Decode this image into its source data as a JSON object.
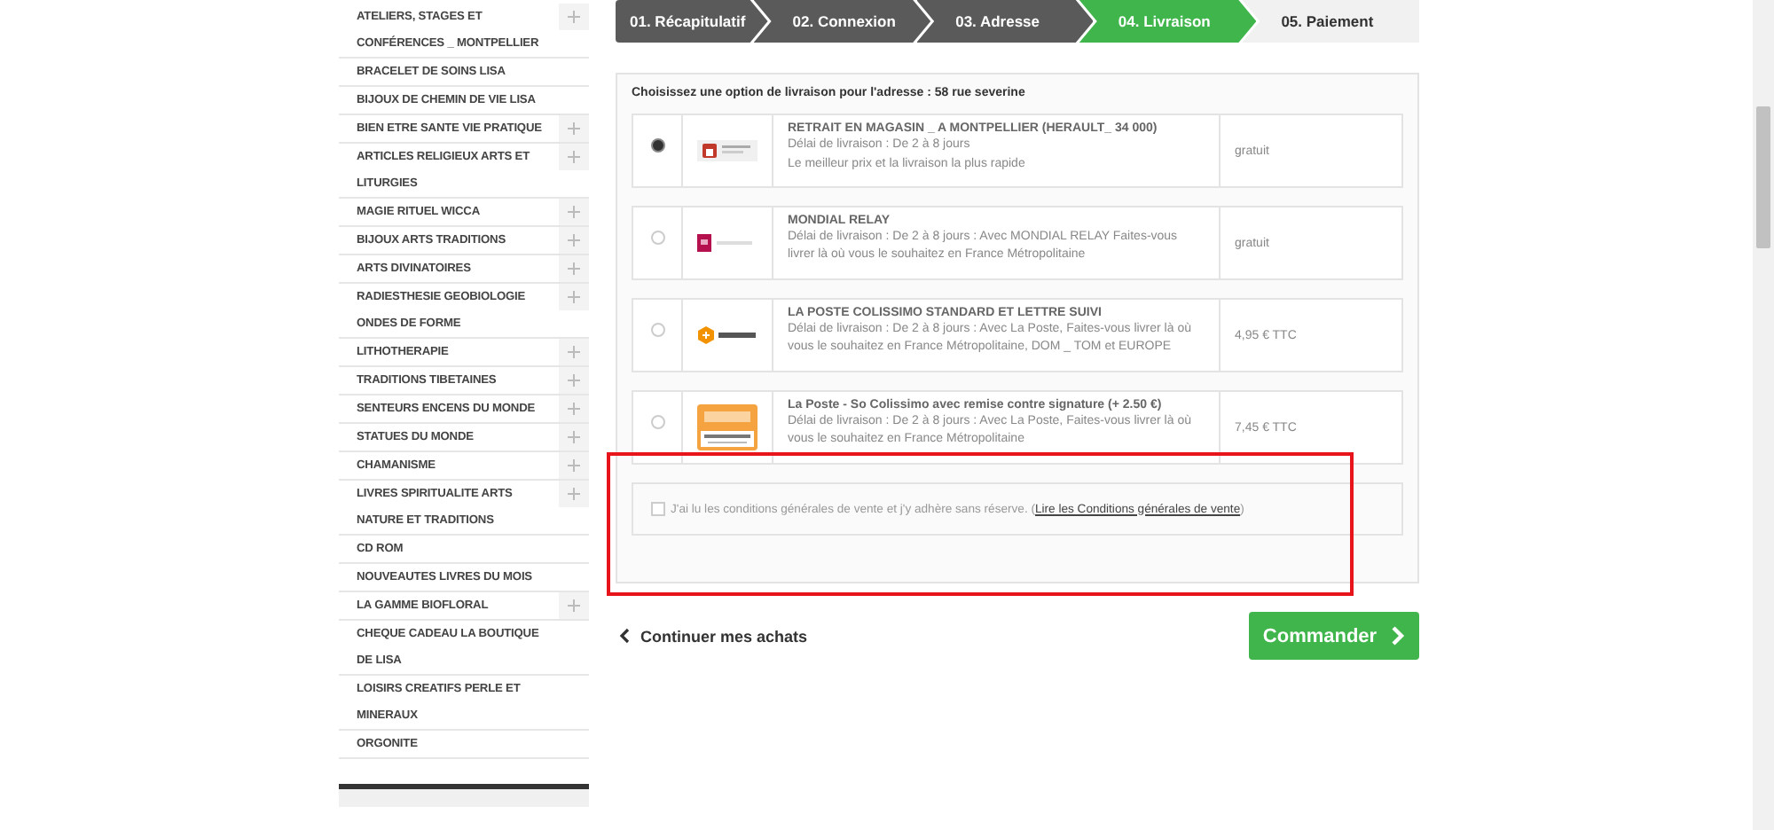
{
  "sidebar": {
    "items": [
      {
        "label": "ATELIERS, STAGES ET CONFÉRENCES _ MONTPELLIER",
        "expandable": true
      },
      {
        "label": "BRACELET DE SOINS LISA",
        "expandable": false
      },
      {
        "label": "BIJOUX DE CHEMIN DE VIE LISA",
        "expandable": false
      },
      {
        "label": "BIEN ETRE SANTE VIE PRATIQUE",
        "expandable": true
      },
      {
        "label": "ARTICLES RELIGIEUX ARTS ET LITURGIES",
        "expandable": true
      },
      {
        "label": "MAGIE RITUEL WICCA",
        "expandable": true
      },
      {
        "label": "BIJOUX ARTS TRADITIONS",
        "expandable": true
      },
      {
        "label": "ARTS DIVINATOIRES",
        "expandable": true
      },
      {
        "label": "RADIESTHESIE GEOBIOLOGIE ONDES DE FORME",
        "expandable": true
      },
      {
        "label": "LITHOTHERAPIE",
        "expandable": true
      },
      {
        "label": "TRADITIONS TIBETAINES",
        "expandable": true
      },
      {
        "label": "SENTEURS ENCENS DU MONDE",
        "expandable": true
      },
      {
        "label": "STATUES DU MONDE",
        "expandable": true
      },
      {
        "label": "CHAMANISME",
        "expandable": true
      },
      {
        "label": "LIVRES SPIRITUALITE ARTS NATURE ET TRADITIONS",
        "expandable": true
      },
      {
        "label": "CD ROM",
        "expandable": false
      },
      {
        "label": "NOUVEAUTES LIVRES DU MOIS",
        "expandable": false
      },
      {
        "label": "LA GAMME BIOFLORAL",
        "expandable": true
      },
      {
        "label": "CHEQUE CADEAU LA BOUTIQUE DE LISA",
        "expandable": false
      },
      {
        "label": "LOISIRS CREATIFS PERLE ET MINERAUX",
        "expandable": false
      },
      {
        "label": "ORGONITE",
        "expandable": false
      }
    ]
  },
  "steps": [
    {
      "label": "01. Récapitulatif",
      "done": true,
      "selected": false
    },
    {
      "label": "02. Connexion",
      "done": true,
      "selected": false
    },
    {
      "label": "03. Adresse",
      "done": true,
      "selected": false
    },
    {
      "label": "04. Livraison",
      "done": false,
      "selected": true
    },
    {
      "label": "05. Paiement",
      "done": false,
      "selected": false
    }
  ],
  "delivery": {
    "title": "Choisissez une option de livraison pour l'adresse : 58 rue severine",
    "options": [
      {
        "kind": "store",
        "selected": true,
        "name": "RETRAIT EN MAGASIN _ A MONTPELLIER (HERAULT_ 34 000)",
        "lines": [
          "Délai de livraison : De 2 à 8 jours",
          "Le meilleur prix et la livraison la plus rapide"
        ],
        "price": "gratuit"
      },
      {
        "kind": "relay",
        "selected": false,
        "name": "MONDIAL RELAY",
        "lines": [
          "Délai de livraison : De 2 à 8 jours : Avec MONDIAL RELAY Faites-vous livrer là où vous le souhaitez en France Métropolitaine"
        ],
        "price": "gratuit"
      },
      {
        "kind": "parcel",
        "selected": false,
        "name": "LA POSTE COLISSIMO STANDARD ET LETTRE SUIVI",
        "lines": [
          "Délai de livraison : De 2 à 8 jours : Avec La Poste, Faites-vous livrer là où vous le souhaitez en France Métropolitaine, DOM _ TOM et EUROPE"
        ],
        "price": "4,95 € TTC"
      },
      {
        "kind": "signature",
        "selected": false,
        "name": "La Poste - So Colissimo avec remise contre signature (+ 2.50 €)",
        "lines": [
          "Délai de livraison : De 2 à 8 jours : Avec La Poste, Faites-vous livrer là où vous le souhaitez en France Métropolitaine"
        ],
        "price": "7,45 € TTC"
      }
    ],
    "terms": {
      "checked": false,
      "text": "J'ai lu les conditions générales de vente et j'y adhère sans réserve. (",
      "link": "Lire les Conditions générales de vente",
      "after": ")"
    }
  },
  "actions": {
    "back": "Continuer mes achats",
    "order": "Commander"
  }
}
